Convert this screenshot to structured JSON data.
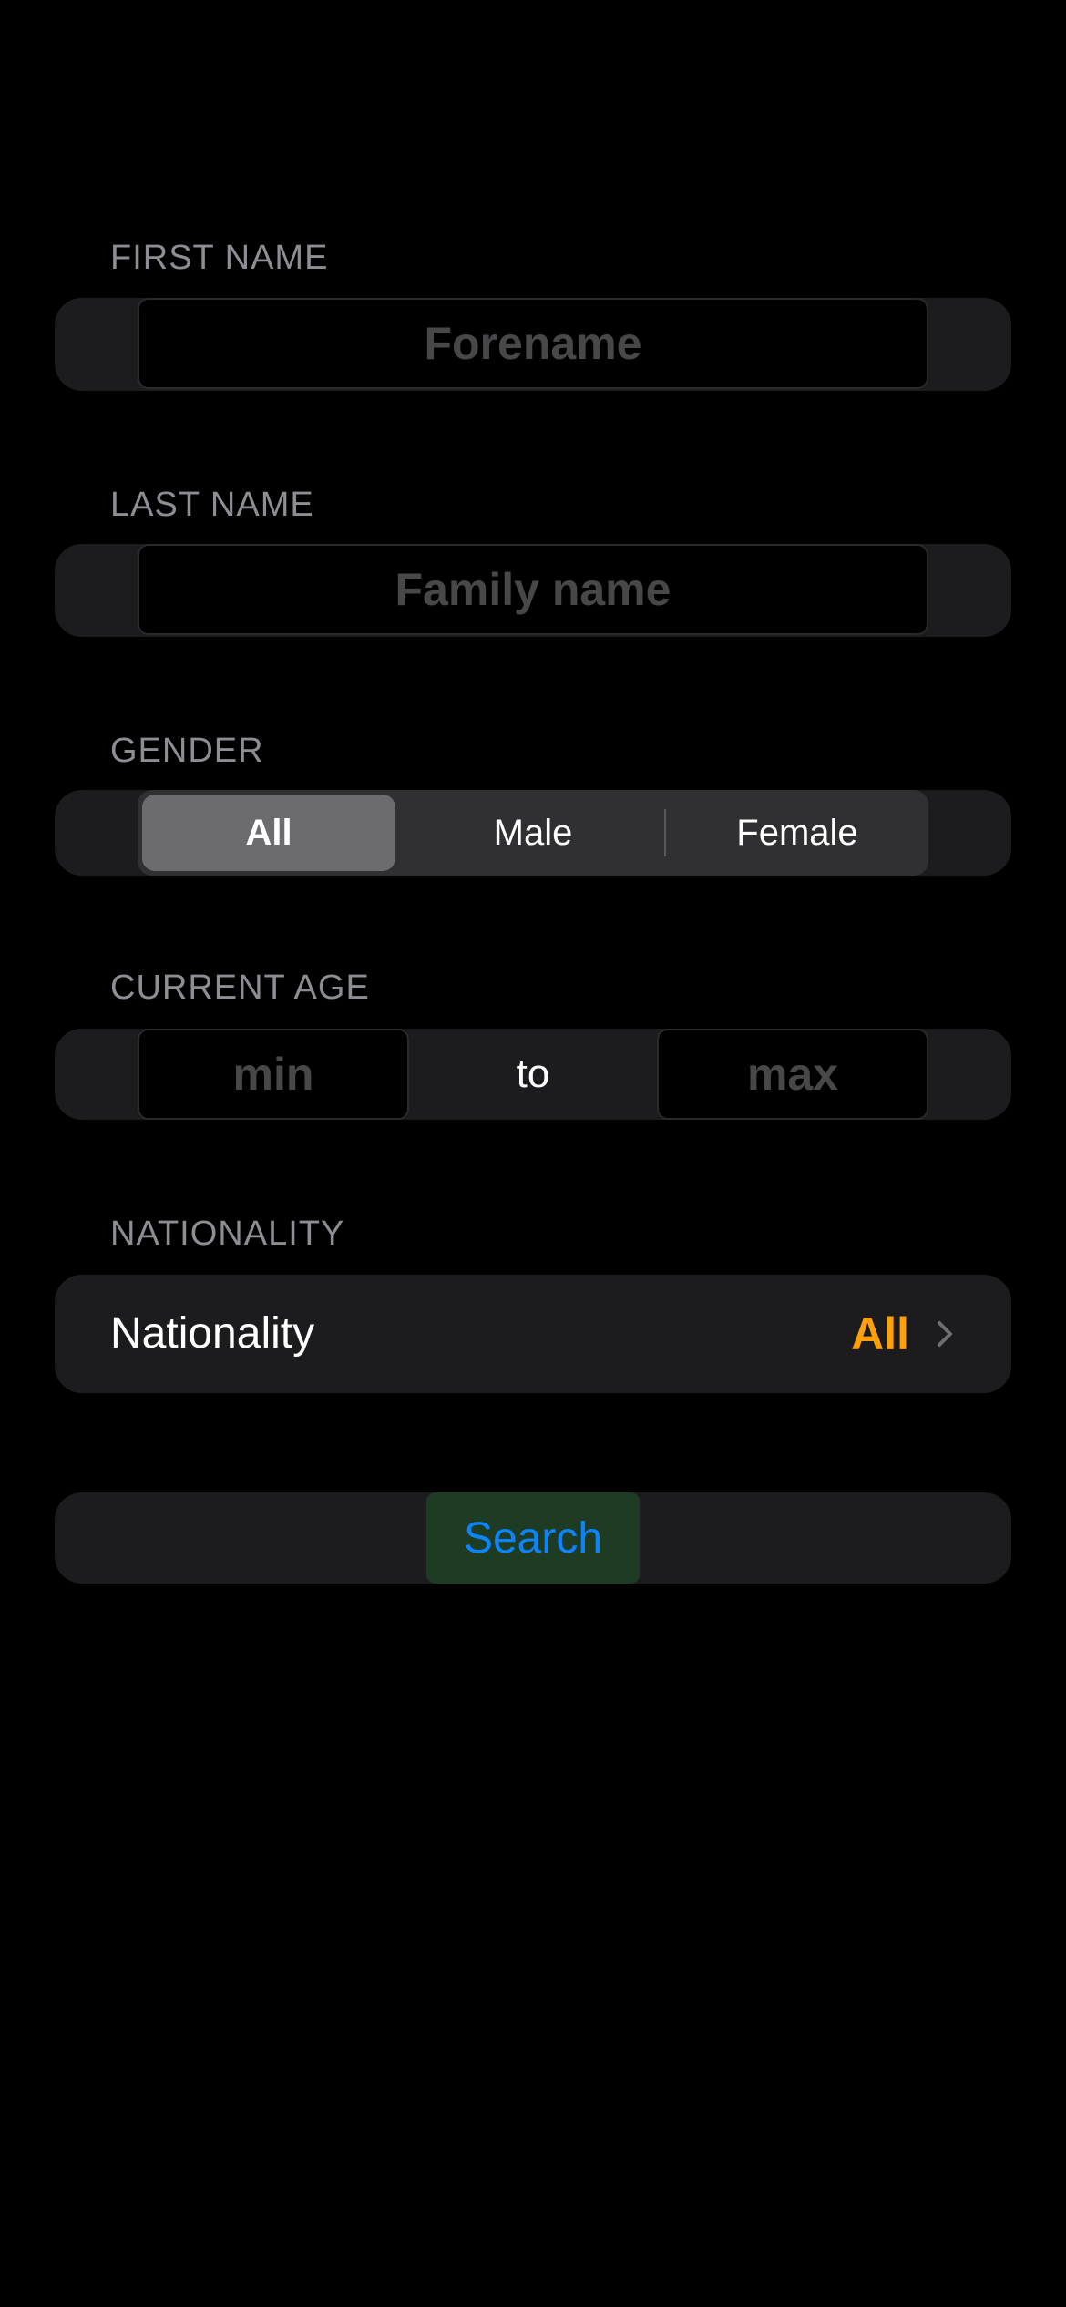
{
  "first_name": {
    "section_label": "FIRST NAME",
    "placeholder": "Forename",
    "value": ""
  },
  "last_name": {
    "section_label": "LAST NAME",
    "placeholder": "Family name",
    "value": ""
  },
  "gender": {
    "section_label": "GENDER",
    "options": [
      {
        "label": "All",
        "selected": true
      },
      {
        "label": "Male",
        "selected": false
      },
      {
        "label": "Female",
        "selected": false
      }
    ]
  },
  "current_age": {
    "section_label": "CURRENT AGE",
    "min_placeholder": "min",
    "max_placeholder": "max",
    "separator": "to"
  },
  "nationality": {
    "section_label": "NATIONALITY",
    "row_label": "Nationality",
    "value": "All",
    "value_color": "#ff9f0a",
    "icon": "chevron-right-icon"
  },
  "search": {
    "label": "Search",
    "text_color": "#0a84ff",
    "background": "#1e3b24"
  }
}
